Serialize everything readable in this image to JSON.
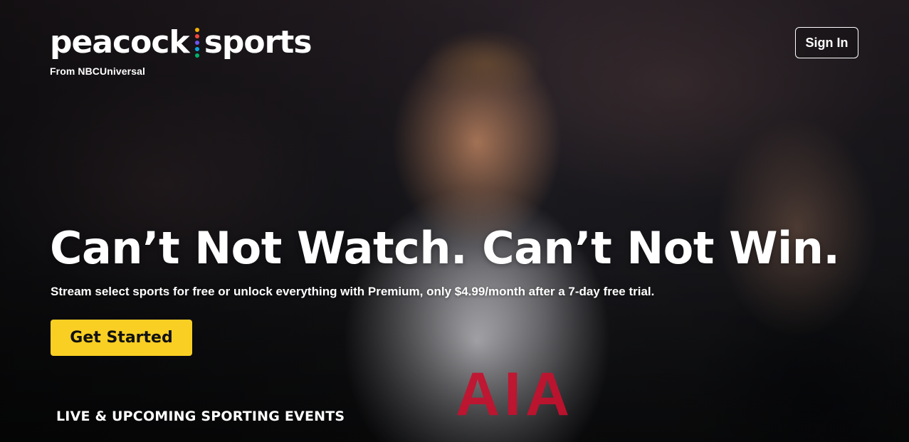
{
  "brand": {
    "name_left": "peacock",
    "name_right": "sports",
    "subtitle": "From NBCUniversal",
    "dot_colors": [
      "#f4b000",
      "#f0483e",
      "#6e54f0",
      "#0aa6e0",
      "#00b16a"
    ]
  },
  "header": {
    "sign_in_label": "Sign In"
  },
  "hero": {
    "headline": "Can’t Not Watch. Can’t Not Win.",
    "subhead": "Stream select sports for free or unlock everything with Premium, only $4.99/month after a 7-day free trial.",
    "cta_label": "Get Started",
    "cta_color": "#f9cf24",
    "jersey_text": "AIA"
  },
  "sections": {
    "live_title": "LIVE & UPCOMING SPORTING EVENTS"
  }
}
